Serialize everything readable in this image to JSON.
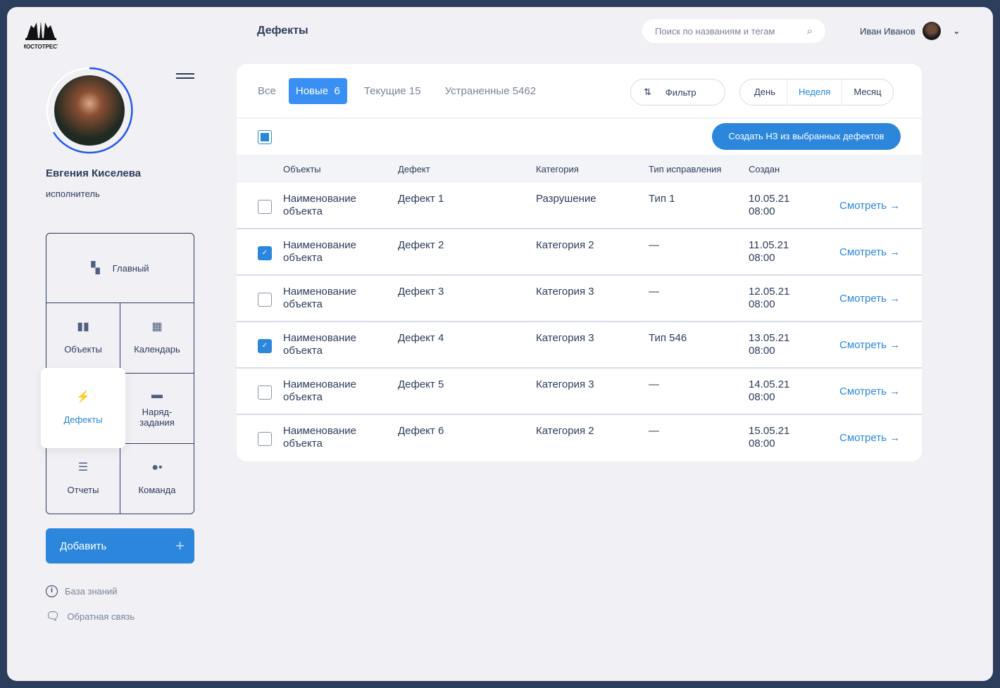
{
  "logo_text": "МОСТОТРЕСТ",
  "profile": {
    "name": "Евгения Киселева",
    "role": "исполнитель"
  },
  "nav": {
    "main": "Главный",
    "objects": "Объекты",
    "calendar": "Календарь",
    "defects": "Дефекты",
    "orders": "Наряд-\nзадания",
    "reports": "Отчеты",
    "team": "Команда"
  },
  "add_label": "Добавить",
  "links": {
    "kb": "База знаний",
    "feedback": "Обратная связь"
  },
  "header": {
    "title": "Дефекты",
    "search_placeholder": "Поиск по названиям и тегам",
    "user": "Иван Иванов"
  },
  "tabs": [
    {
      "label": "Все"
    },
    {
      "label": "Новые  6"
    },
    {
      "label": "Текущие 15"
    },
    {
      "label": "Устраненные 5462"
    }
  ],
  "filter_label": "Фильтр",
  "periods": [
    "День",
    "Неделя",
    "Месяц"
  ],
  "create_label": "Создать НЗ из выбранных дефектов",
  "columns": [
    "Объекты",
    "Дефект",
    "Категория",
    "Тип исправления",
    "Создан"
  ],
  "view_label": "Смотреть →",
  "rows": [
    {
      "object": "Наименование объекта",
      "defect": "Дефект 1",
      "category": "Разрушение",
      "fix": "Тип 1",
      "date": "10.05.21",
      "time": "08:00",
      "checked": false
    },
    {
      "object": "Наименование объекта",
      "defect": "Дефект 2",
      "category": "Категория 2",
      "fix": "—",
      "date": "11.05.21",
      "time": "08:00",
      "checked": true
    },
    {
      "object": "Наименование объекта",
      "defect": "Дефект 3",
      "category": "Категория 3",
      "fix": "—",
      "date": "12.05.21",
      "time": "08:00",
      "checked": false
    },
    {
      "object": "Наименование объекта",
      "defect": "Дефект 4",
      "category": "Категория 3",
      "fix": "Тип 546",
      "date": "13.05.21",
      "time": "08:00",
      "checked": true
    },
    {
      "object": "Наименование объекта",
      "defect": "Дефект 5",
      "category": "Категория 3",
      "fix": "—",
      "date": "14.05.21",
      "time": "08:00",
      "checked": false
    },
    {
      "object": "Наименование объекта",
      "defect": "Дефект 6",
      "category": "Категория 2",
      "fix": "—",
      "date": "15.05.21",
      "time": "08:00",
      "checked": false
    }
  ],
  "colors": {
    "accent": "#2b86dc",
    "navy": "#2d3d5c",
    "bg": "#f0f0f5"
  }
}
